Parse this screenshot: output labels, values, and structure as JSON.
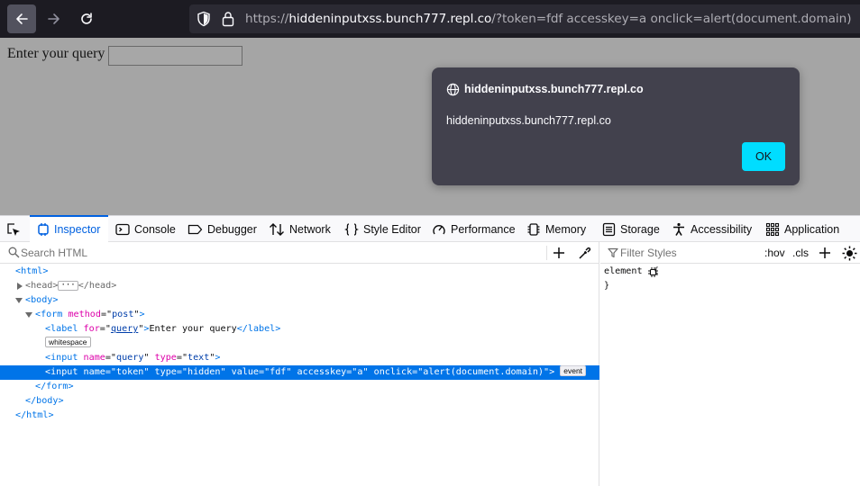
{
  "browser": {
    "url_prefix": "https://",
    "url_host": "hiddeninputxss.bunch777.repl.co",
    "url_rest": "/?token=fdf accesskey=a onclick=alert(document.domain)"
  },
  "page": {
    "label": "Enter your query",
    "input_value": ""
  },
  "dialog": {
    "origin": "hiddeninputxss.bunch777.repl.co",
    "message": "hiddeninputxss.bunch777.repl.co",
    "ok_label": "OK"
  },
  "devtools": {
    "tabs": [
      {
        "label": "Inspector",
        "icon": "inspector-icon"
      },
      {
        "label": "Console",
        "icon": "console-icon"
      },
      {
        "label": "Debugger",
        "icon": "debugger-icon"
      },
      {
        "label": "Network",
        "icon": "network-icon"
      },
      {
        "label": "Style Editor",
        "icon": "style-editor-icon"
      },
      {
        "label": "Performance",
        "icon": "performance-icon"
      },
      {
        "label": "Memory",
        "icon": "memory-icon"
      },
      {
        "label": "Storage",
        "icon": "storage-icon"
      },
      {
        "label": "Accessibility",
        "icon": "accessibility-icon"
      },
      {
        "label": "Application",
        "icon": "application-icon"
      }
    ],
    "active_tab": "Inspector",
    "search_placeholder": "Search HTML",
    "filter_placeholder": "Filter Styles",
    "hov_label": ":hov",
    "cls_label": ".cls",
    "rule_open": "element  {",
    "rule_close": "}",
    "markup": {
      "html_open": "html",
      "head": "head",
      "body_open": "body",
      "form_tag": "form",
      "form_attr": "method",
      "form_val": "post",
      "label_tag": "label",
      "label_attr": "for",
      "label_val": "query",
      "label_text": "Enter your query",
      "whitespace_badge": "whitespace",
      "input1_tag": "input",
      "input1_a1": "name",
      "input1_v1": "query",
      "input1_a2": "type",
      "input1_v2": "text",
      "selected_line": "<input name=\"token\" type=\"hidden\" value=\"fdf\" accesskey=\"a\" onclick=\"alert(document.domain)\">",
      "event_badge": "event",
      "form_close": "form",
      "body_close": "body",
      "html_close": "html"
    }
  },
  "colors": {
    "toolbar_bg": "#1c1b22",
    "dialog_bg": "#42414d",
    "ok_button": "#00ddff",
    "selection": "#0074e8",
    "active_tab": "#0061e0"
  }
}
